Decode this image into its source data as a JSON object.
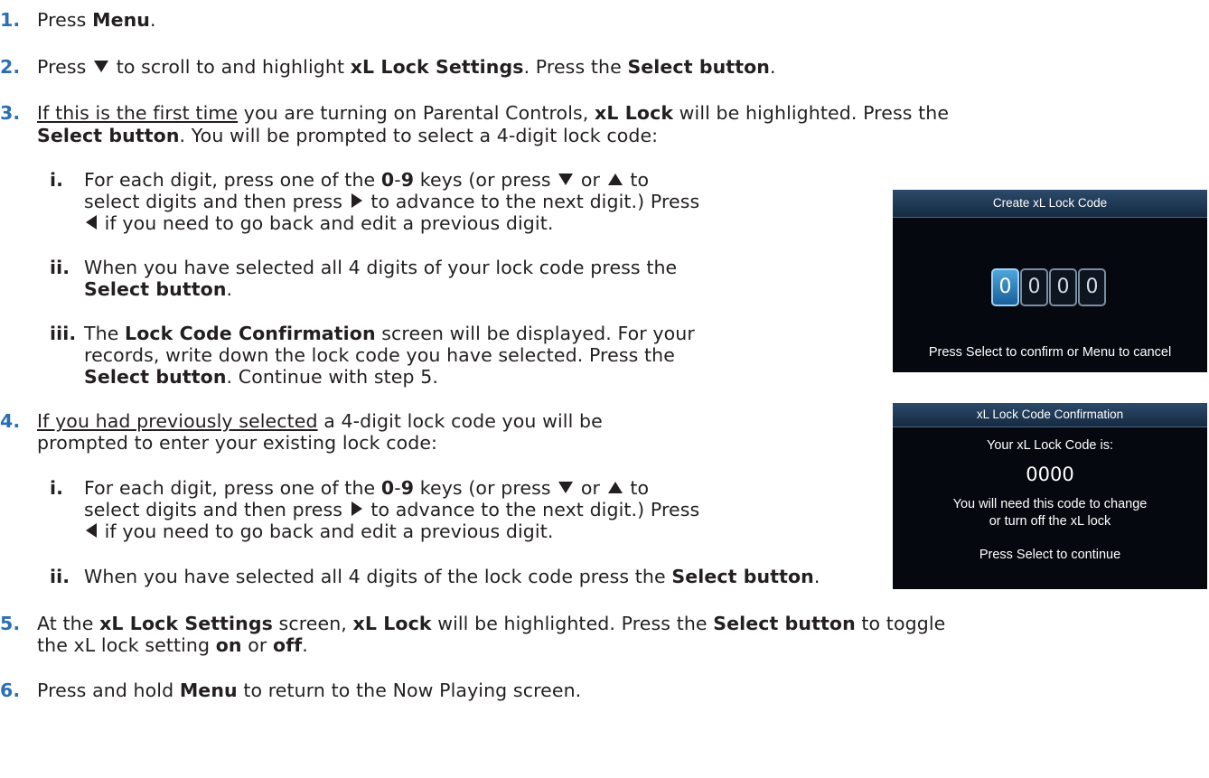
{
  "steps": {
    "s1": {
      "num": "1.",
      "pre": "Press ",
      "b1": "Menu",
      "post": "."
    },
    "s2": {
      "num": "2.",
      "pre": "Press ",
      "mid": " to scroll to and highlight ",
      "b1": "xL Lock Settings",
      "mid2": ". Press the ",
      "b2": "Select button",
      "post": "."
    },
    "s3": {
      "num": "3.",
      "u1": "If this is the first time",
      "t1": " you are turning on Parental Controls, ",
      "b1": "xL Lock",
      "t2": " will be highlighted. Press the",
      "b2": "Select button",
      "t3": ". You will be prompted to select a 4-digit lock code:",
      "i": {
        "label": "i.",
        "t1": "For each digit, press one of the ",
        "b1": "0",
        "dash": "-",
        "b2": "9",
        "t2": " keys (or press ",
        "or": " or ",
        "to": " to",
        "l2a": "select digits and then press ",
        "l2b": " to advance to the next digit.) Press",
        "l3": " if you need to go back and edit a previous digit."
      },
      "ii": {
        "label": "ii.",
        "t1": "When you have selected all 4 digits of your lock code press the",
        "b1": "Select button",
        "post": "."
      },
      "iii": {
        "label": "iii.",
        "t1": "The ",
        "b1": "Lock Code Confirmation",
        "t2": " screen will be displayed. For your",
        "l2": "records, write down the lock code you have selected. Press the",
        "b2": "Select button",
        "t3": ". Continue with step 5."
      }
    },
    "s4": {
      "num": "4.",
      "u1": "If you had previously selected",
      "t1": " a 4-digit lock code you will be",
      "l2": "prompted to enter your existing lock code:",
      "i": {
        "label": "i.",
        "t1": "For each digit, press one of the ",
        "b1": "0",
        "dash": "-",
        "b2": "9",
        "t2": " keys (or press ",
        "or": " or ",
        "to": " to",
        "l2a": "select digits and then press ",
        "l2b": " to advance to the next digit.) Press",
        "l3": " if you need to go back and edit a previous digit."
      },
      "ii": {
        "label": "ii.",
        "t1": "When you have selected all 4 digits of the lock code press the ",
        "b1": "Select button",
        "post": "."
      }
    },
    "s5": {
      "num": "5.",
      "t1": "At the ",
      "b1": "xL Lock Settings",
      "t2": " screen, ",
      "b2": "xL Lock",
      "t3": " will be highlighted. Press the ",
      "b3": "Select button",
      "t4": " to toggle",
      "l2a": "the xL lock setting ",
      "b4": "on",
      "l2b": " or ",
      "b5": "off",
      "post": "."
    },
    "s6": {
      "num": "6.",
      "pre": "Press and hold ",
      "b1": "Menu",
      "post": " to return to the Now Playing screen."
    }
  },
  "screen1": {
    "title": "Create xL Lock Code",
    "digits": [
      "0",
      "0",
      "0",
      "0"
    ],
    "footer": "Press Select to confirm or Menu to cancel"
  },
  "screen2": {
    "title": "xL Lock Code Confirmation",
    "line1": "Your xL Lock Code is:",
    "code": "0000",
    "line2": "You will need this code to change",
    "line3": "or turn off the xL lock",
    "footer": "Press Select to continue"
  },
  "colors": {
    "step_number": "#2a6fb5",
    "screen_bg": "#05090f",
    "screen_header": "#213a57",
    "digit_selected": "#2f86c6"
  }
}
